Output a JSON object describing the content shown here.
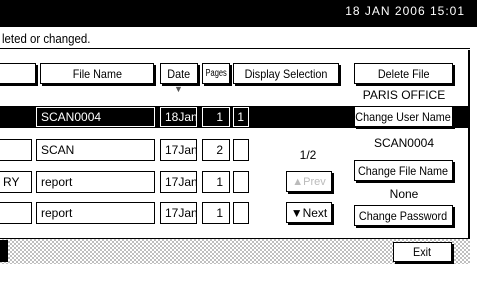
{
  "status": {
    "clock": "18 JAN  2006 15:01"
  },
  "message": "leted or changed.",
  "table": {
    "headers": {
      "file_name": "File Name",
      "date": "Date",
      "pages": "Pages",
      "display_selection": "Display Selection",
      "sort_marker": "▼"
    },
    "rows": [
      {
        "user": "",
        "file": "SCAN0004",
        "date": "18Jan.",
        "pages": "1",
        "order": "1",
        "selected": true
      },
      {
        "user": "",
        "file": "SCAN",
        "date": "17Jan.",
        "pages": "2",
        "order": "",
        "selected": false
      },
      {
        "user": "RY",
        "file": "report",
        "date": "17Jan.",
        "pages": "1",
        "order": "",
        "selected": false
      },
      {
        "user": "",
        "file": "report",
        "date": "17Jan.",
        "pages": "1",
        "order": "",
        "selected": false
      }
    ]
  },
  "pager": {
    "page": "1/2",
    "prev_label": "▲Prev",
    "next_label": "▼Next"
  },
  "side": {
    "delete_file": "Delete File",
    "user_name_value": "PARIS OFFICE",
    "change_user_name": "Change User Name",
    "file_name_value": "SCAN0004",
    "change_file_name": "Change File Name",
    "password_value": "None",
    "change_password": "Change Password"
  },
  "footer": {
    "exit": "Exit"
  }
}
